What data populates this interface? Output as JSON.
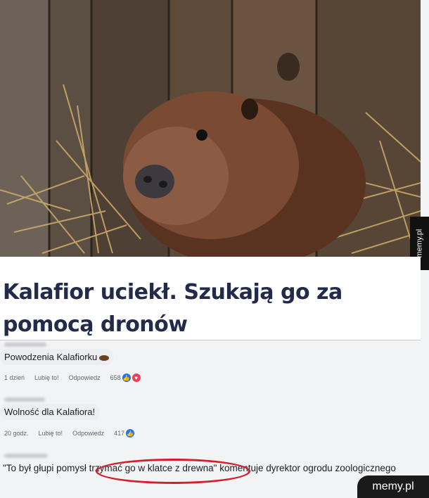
{
  "article": {
    "headline": "Kalafior uciekł. Szukają go za pomocą dronów"
  },
  "watermarks": {
    "side": "memy.pl",
    "corner": "memy.pl"
  },
  "comments": [
    {
      "text": "Powodzenia Kalafiorku",
      "emoji": "beaver-emoji",
      "time": "1 dzień",
      "like": "Lubię to!",
      "reply": "Odpowiedz",
      "reactions_count": "658",
      "reaction_icons": [
        "like",
        "love"
      ]
    },
    {
      "text": "Wolność dla Kalafiora!",
      "time": "20 godz.",
      "like": "Lubię to!",
      "reply": "Odpowiedz",
      "reactions_count": "417",
      "reaction_icons": [
        "like"
      ]
    },
    {
      "text": "\"To był głupi pomysł trzymać go w klatce z drewna\" komentuje dyrektor ogrodu zoologicznego"
    }
  ],
  "colors": {
    "headline": "#232a4a",
    "like": "#1877f2",
    "love": "#f33e58",
    "annotation_circle": "#d3202d"
  }
}
